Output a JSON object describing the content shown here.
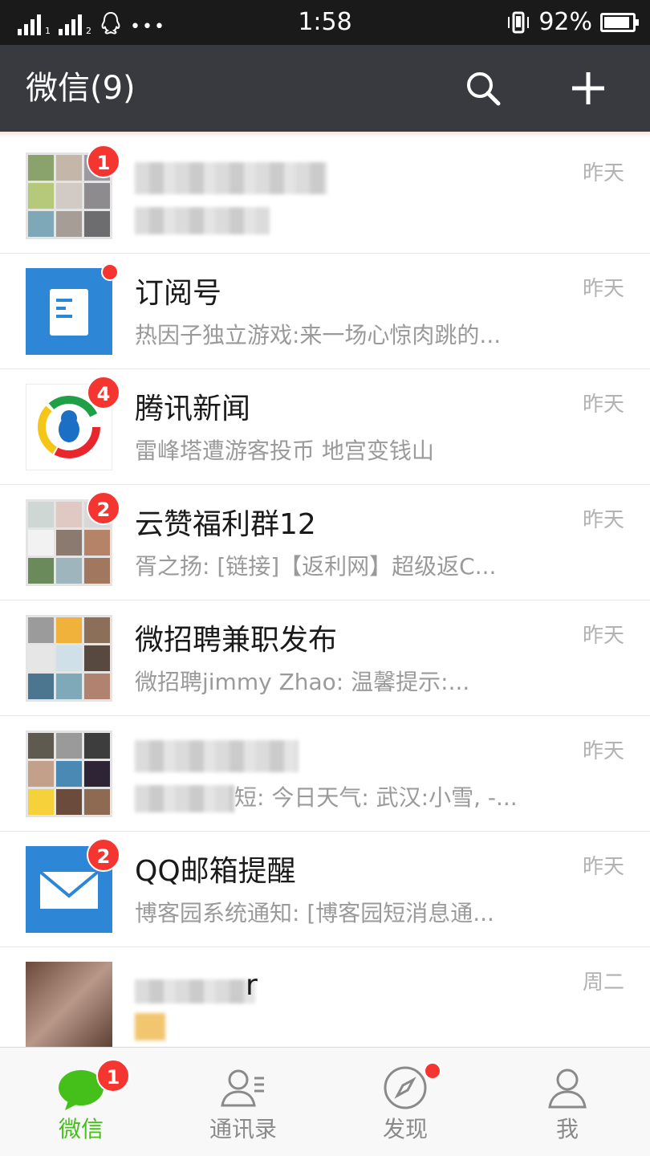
{
  "status_bar": {
    "time": "1:58",
    "battery": "92%",
    "battery_level": 0.92,
    "sim1_label": "1",
    "sim2_label": "2",
    "more_indicator": "•••"
  },
  "header": {
    "title": "微信(9)",
    "search_icon": "search-icon",
    "add_icon": "plus-icon"
  },
  "chats": [
    {
      "name": "",
      "preview": "",
      "time": "昨天",
      "badge": "1",
      "avatar": "group-mosaic"
    },
    {
      "name": "订阅号",
      "preview": "热因子独立游戏:来一场心惊肉跳的...",
      "time": "昨天",
      "badge": "",
      "avatar": "subscription-icon"
    },
    {
      "name": "腾讯新闻",
      "preview": "雷峰塔遭游客投币 地宫变钱山",
      "time": "昨天",
      "badge": "4",
      "avatar": "tencent-news-logo"
    },
    {
      "name": "云赞福利群12",
      "preview": "胥之扬: [链接]【返利网】超级返C...",
      "time": "昨天",
      "badge": "2",
      "avatar": "group-mosaic"
    },
    {
      "name": "微招聘兼职发布",
      "preview": "微招聘jimmy Zhao: 温馨提示:...",
      "time": "昨天",
      "badge": "",
      "avatar": "group-mosaic"
    },
    {
      "name": "",
      "preview": "短: 今日天气: 武汉:小雪, -...",
      "time": "昨天",
      "badge": "",
      "avatar": "group-mosaic"
    },
    {
      "name": "QQ邮箱提醒",
      "preview": "博客园系统通知: [博客园短消息通...",
      "time": "昨天",
      "badge": "2",
      "avatar": "mail-icon"
    },
    {
      "name": "r",
      "preview": "",
      "time": "周二",
      "badge": "",
      "avatar": "photo"
    }
  ],
  "tabs": [
    {
      "label": "微信",
      "icon": "chat-bubble-icon",
      "active": true,
      "badge": "1"
    },
    {
      "label": "通讯录",
      "icon": "contacts-icon",
      "active": false
    },
    {
      "label": "发现",
      "icon": "compass-icon",
      "active": false,
      "dot": true
    },
    {
      "label": "我",
      "icon": "profile-icon",
      "active": false
    }
  ],
  "colors": {
    "header_bg": "#393a3f",
    "status_bg": "#1a1a1a",
    "badge_red": "#f43530",
    "tab_active_green": "#45c01a",
    "subscription_blue": "#2e86d6",
    "mail_blue": "#2e86d6"
  }
}
